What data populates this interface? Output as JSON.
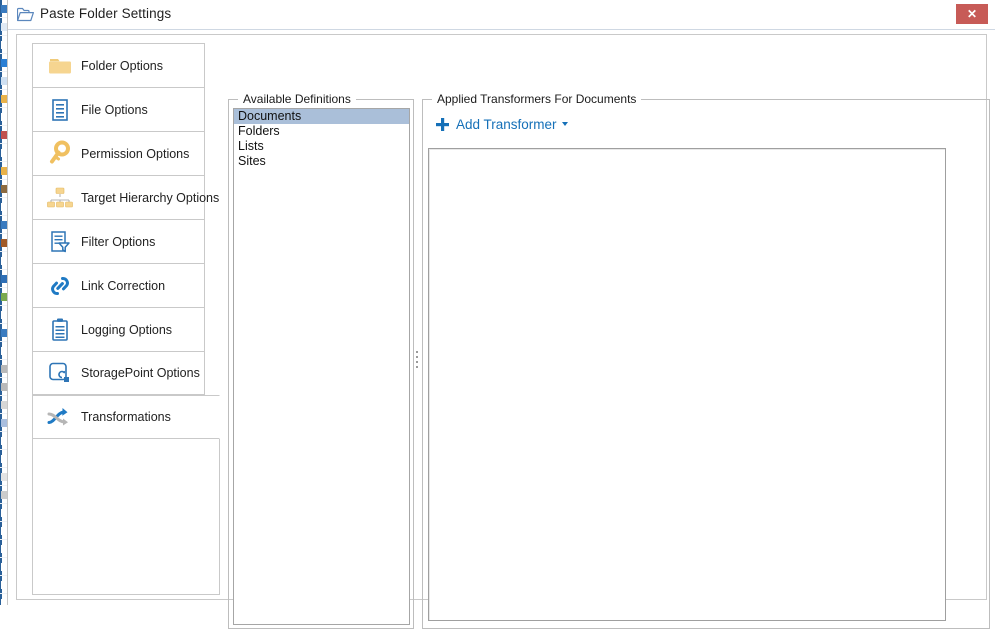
{
  "window": {
    "title": "Paste Folder Settings",
    "title_icon": "folder-open-icon",
    "close_label": "✕",
    "close_color": "#c75b57"
  },
  "sidebar": {
    "items": [
      {
        "label": "Folder Options",
        "icon": "folder-icon",
        "active": false
      },
      {
        "label": "File Options",
        "icon": "file-icon",
        "active": false
      },
      {
        "label": "Permission Options",
        "icon": "key-icon",
        "active": false
      },
      {
        "label": "Target Hierarchy Options",
        "icon": "hierarchy-icon",
        "active": false
      },
      {
        "label": "Filter Options",
        "icon": "filter-icon",
        "active": false
      },
      {
        "label": "Link Correction",
        "icon": "link-icon",
        "active": false
      },
      {
        "label": "Logging Options",
        "icon": "clipboard-icon",
        "active": false
      },
      {
        "label": "StoragePoint Options",
        "icon": "storagepoint-icon",
        "active": false
      },
      {
        "label": "Transformations",
        "icon": "transform-icon",
        "active": true
      }
    ]
  },
  "definitions_panel": {
    "title": "Available Definitions",
    "items": [
      {
        "label": "Documents",
        "selected": true
      },
      {
        "label": "Folders",
        "selected": false
      },
      {
        "label": "Lists",
        "selected": false
      },
      {
        "label": "Sites",
        "selected": false
      }
    ],
    "selection_color": "#aabfd9"
  },
  "applied_panel": {
    "title": "Applied Transformers For Documents",
    "add_transformer_label": "Add Transformer",
    "add_transformer_icon": "plus-icon",
    "accent_color": "#1570b8",
    "list_items": []
  },
  "toolbar": {
    "buttons": [
      {
        "name": "help",
        "icon": "help-icon",
        "enabled": true
      },
      {
        "name": "move-up",
        "icon": "arrow-up-icon",
        "enabled": false
      },
      {
        "name": "move-down",
        "icon": "arrow-down-icon",
        "enabled": false
      },
      {
        "name": "edit",
        "icon": "edit-icon",
        "enabled": false
      },
      {
        "name": "delete",
        "icon": "delete-icon",
        "enabled": false
      }
    ]
  },
  "splitter": {
    "name": "vertical-splitter"
  }
}
